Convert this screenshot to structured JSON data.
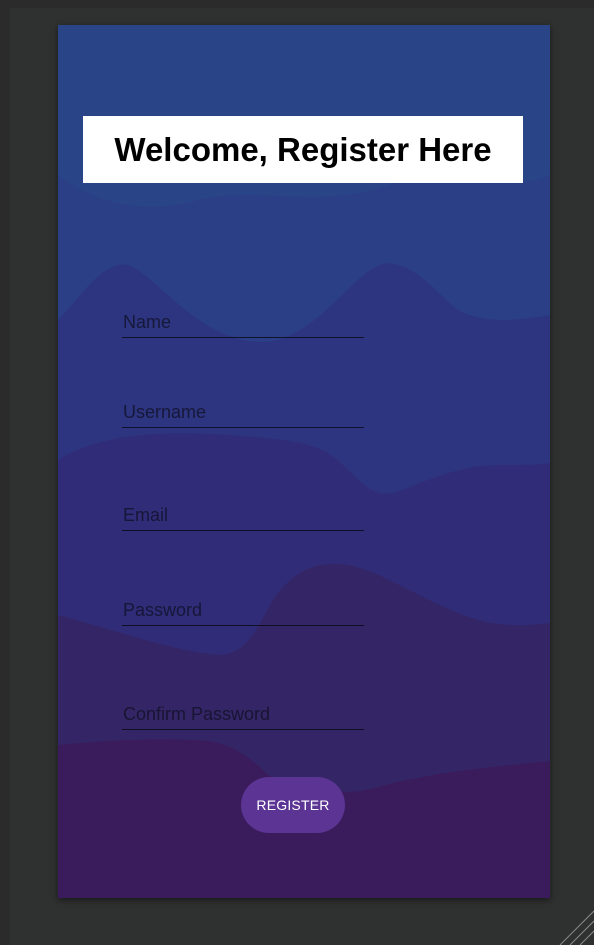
{
  "header": {
    "title": "Welcome, Register Here"
  },
  "form": {
    "fields": [
      {
        "placeholder": "Name",
        "value": ""
      },
      {
        "placeholder": "Username",
        "value": ""
      },
      {
        "placeholder": "Email",
        "value": ""
      },
      {
        "placeholder": "Password",
        "value": ""
      },
      {
        "placeholder": "Confirm Password",
        "value": ""
      }
    ],
    "submit_label": "REGISTER"
  },
  "colors": {
    "background_top": "#2a4488",
    "background_bottom": "#3c1858",
    "button": "#5c3494",
    "header_bg": "#ffffff"
  }
}
